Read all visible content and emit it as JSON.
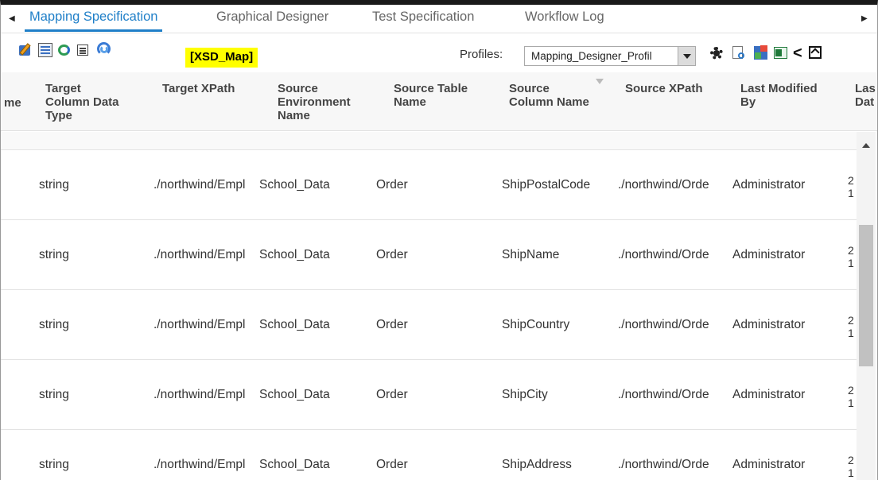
{
  "tabs": [
    {
      "label": "Mapping Specification",
      "active": true
    },
    {
      "label": "Graphical Designer",
      "active": false
    },
    {
      "label": "Test Specification",
      "active": false
    },
    {
      "label": "Workflow Log",
      "active": false
    }
  ],
  "toolbar": {
    "map_name": "[XSD_Map]",
    "profiles_label": "Profiles:",
    "profile_value": "Mapping_Designer_Profil",
    "left_icons": [
      "edit-icon",
      "grid-icon",
      "sync-icon",
      "list-icon",
      "refresh-icon"
    ],
    "right_icons": [
      "settings-gear-icon",
      "preview-icon",
      "etl-icon",
      "excel-export-icon",
      "share-icon",
      "expand-icon"
    ]
  },
  "columns": {
    "name_partial": "me",
    "target_column_data_type": "Target\nColumn Data\nType",
    "target_xpath": "Target XPath",
    "source_environment_name": "Source\nEnvironment\nName",
    "source_table_name": "Source Table\nName",
    "source_column_name": "Source\nColumn Name",
    "source_xpath": "Source XPath",
    "last_modified_by": "Last Modified\nBy",
    "last_modified_date_partial": "Las\nDat"
  },
  "rows": [
    {
      "type": "string",
      "target_xpath": "./northwind/Empl",
      "env": "School_Data",
      "table": "Order",
      "column": "ShipPostalCode",
      "source_xpath": "./northwind/Orde",
      "modified_by": "Administrator",
      "date_partial": "2\n1"
    },
    {
      "type": "string",
      "target_xpath": "./northwind/Empl",
      "env": "School_Data",
      "table": "Order",
      "column": "ShipName",
      "source_xpath": "./northwind/Orde",
      "modified_by": "Administrator",
      "date_partial": "2\n1"
    },
    {
      "type": "string",
      "target_xpath": "./northwind/Empl",
      "env": "School_Data",
      "table": "Order",
      "column": "ShipCountry",
      "source_xpath": "./northwind/Orde",
      "modified_by": "Administrator",
      "date_partial": "2\n1"
    },
    {
      "type": "string",
      "target_xpath": "./northwind/Empl",
      "env": "School_Data",
      "table": "Order",
      "column": "ShipCity",
      "source_xpath": "./northwind/Orde",
      "modified_by": "Administrator",
      "date_partial": "2\n1"
    },
    {
      "type": "string",
      "target_xpath": "./northwind/Empl",
      "env": "School_Data",
      "table": "Order",
      "column": "ShipAddress",
      "source_xpath": "./northwind/Orde",
      "modified_by": "Administrator",
      "date_partial": "2\n1"
    }
  ],
  "colors": {
    "accent": "#1f7fc8",
    "highlight": "#ffff00"
  }
}
